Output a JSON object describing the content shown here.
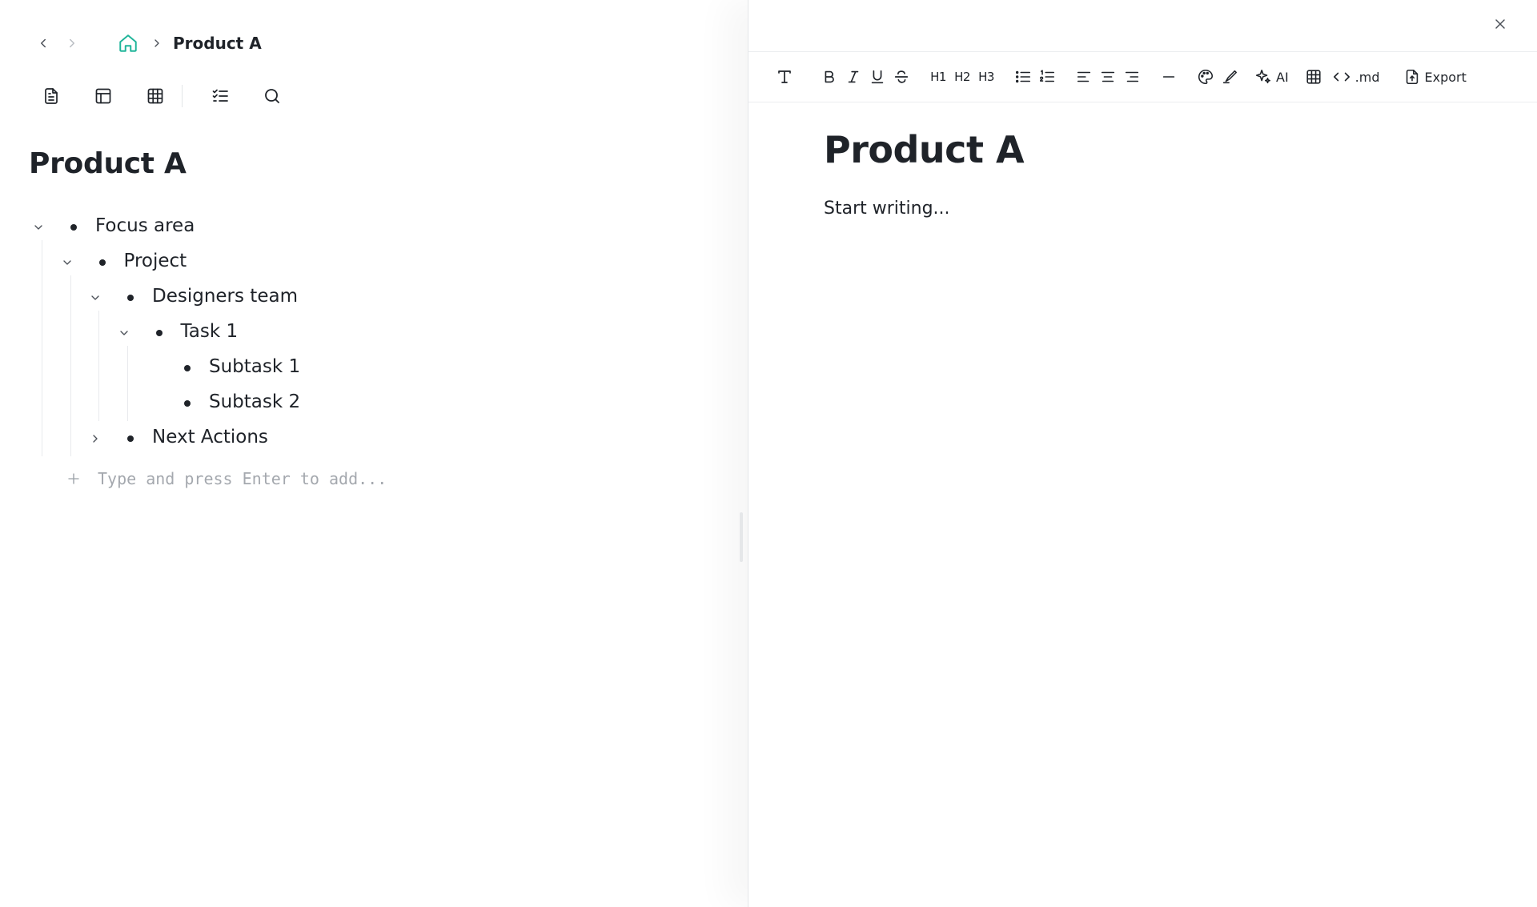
{
  "breadcrumb": {
    "current": "Product A"
  },
  "left": {
    "title": "Product A",
    "tree": [
      {
        "label": "Focus area",
        "depth": 0,
        "expanded": true,
        "has_children": true
      },
      {
        "label": "Project",
        "depth": 1,
        "expanded": true,
        "has_children": true
      },
      {
        "label": "Designers team",
        "depth": 2,
        "expanded": true,
        "has_children": true
      },
      {
        "label": "Task 1",
        "depth": 3,
        "expanded": true,
        "has_children": true
      },
      {
        "label": "Subtask 1",
        "depth": 4,
        "expanded": false,
        "has_children": false
      },
      {
        "label": "Subtask 2",
        "depth": 4,
        "expanded": false,
        "has_children": false
      },
      {
        "label": "Next Actions",
        "depth": 2,
        "expanded": false,
        "has_children": true
      }
    ],
    "add_placeholder": "Type and press Enter to add..."
  },
  "editor": {
    "toolbar": {
      "ai_label": "AI",
      "markdown_label": ".md",
      "export_label": "Export",
      "h1": "H1",
      "h2": "H2",
      "h3": "H3"
    },
    "title": "Product A",
    "body_placeholder": "Start writing..."
  },
  "colors": {
    "accent": "#20b59a",
    "text": "#1f2329",
    "muted": "#a4a8ae"
  },
  "icons": {
    "nav": [
      "chevron-left-icon",
      "chevron-right-icon",
      "home-icon"
    ],
    "view_tools": [
      "document-icon",
      "layout-icon",
      "grid-icon",
      "checklist-icon",
      "search-icon"
    ]
  }
}
